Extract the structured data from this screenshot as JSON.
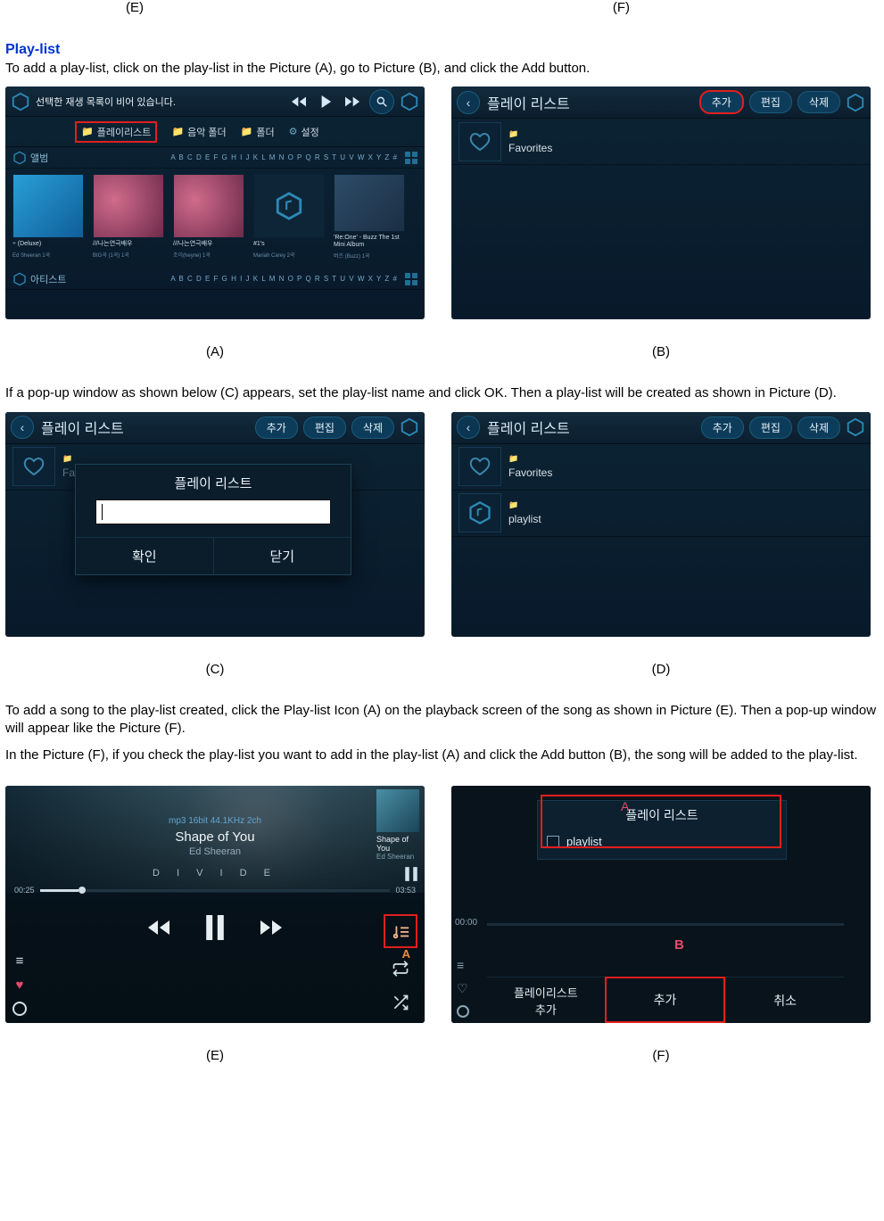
{
  "labels": {
    "E_top": "(E)",
    "F_top": "(F)",
    "A": "(A)",
    "B": "(B)",
    "C": "(C)",
    "D": "(D)",
    "E": "(E)",
    "F": "(F)"
  },
  "section_title": "Play-list",
  "intro": "To add a play-list, click on the play-list in the Picture (A), go to Picture (B), and click the Add button.",
  "para2": "If a pop-up window as shown below (C) appears, set the play-list name and click OK. Then a play-list will be created as shown in Picture (D).",
  "para3a": "To add a song to the play-list created, click the Play-list Icon (A) on the playback screen of the song as shown in Picture (E). Then a pop-up window will appear like the Picture (F).",
  "para3b": "In the Picture (F), if you check the play-list you want to add in the play-list (A) and click the Add button (B), the song will be added to the play-list.",
  "imgA": {
    "msg": "선택한 재생 목록이 비어 있습니다.",
    "tabs": {
      "playlist": "플레이리스트",
      "musicfolder": "음악 폴더",
      "folder": "폴더",
      "settings": "설정"
    },
    "rowAlbum": "앨범",
    "rowArtist": "아티스트",
    "alpha": "A B C D E F G H I J K L M N O P Q R S T U V W X Y Z #",
    "cards": [
      {
        "t": "÷ (Deluxe)",
        "s": "Ed Sheeran 1곡"
      },
      {
        "t": "///나는연극배우",
        "s": "BIG곡 (1곡) 1곡"
      },
      {
        "t": "///나는연극배우",
        "s": "조이(heyne) 1곡"
      },
      {
        "t": "#1's",
        "s": "Mariah Carey 2곡"
      },
      {
        "t": "'Re:One' - Buzz The 1st Mini Album",
        "s": "버즈 (Buzz) 1곡"
      }
    ]
  },
  "imgB": {
    "title": "플레이 리스트",
    "add": "추가",
    "edit": "편집",
    "del": "삭제",
    "fav": "Favorites"
  },
  "imgC": {
    "title": "플레이 리스트",
    "add": "추가",
    "edit": "편집",
    "del": "삭제",
    "fav": "Favo",
    "popup_title": "플레이 리스트",
    "ok": "확인",
    "close": "닫기"
  },
  "imgD": {
    "title": "플레이 리스트",
    "add": "추가",
    "edit": "편집",
    "del": "삭제",
    "fav": "Favorites",
    "pl": "playlist"
  },
  "imgE": {
    "meta": "mp3 16bit 44.1KHz 2ch",
    "title": "Shape of You",
    "artist": "Ed Sheeran",
    "divide": "D I V I D E",
    "t1": "00:25",
    "t2": "03:53",
    "corner_title": "Shape of You",
    "corner_artist": "Ed Sheeran",
    "label": "A"
  },
  "imgF": {
    "ptitle": "플레이 리스트",
    "row": "playlist",
    "btn1": "플레이리스트\n추가",
    "btn2": "추가",
    "btn3": "취소",
    "lblA": "A",
    "lblB": "B",
    "t": "00:00"
  }
}
